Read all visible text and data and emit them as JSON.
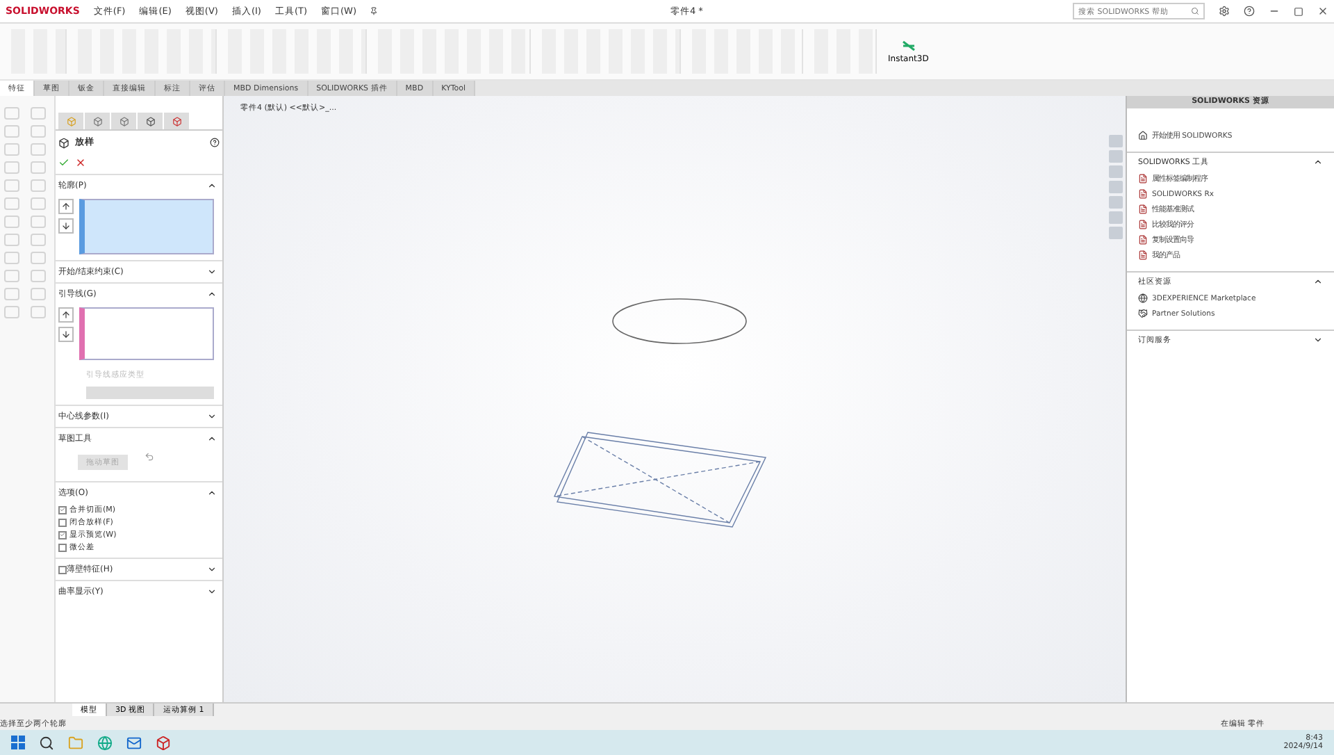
{
  "titlebar": {
    "logo": "SOLIDWORKS",
    "menus": [
      "文件(F)",
      "编辑(E)",
      "视图(V)",
      "插入(I)",
      "工具(T)",
      "窗口(W)"
    ],
    "title": "零件4 *",
    "search": {
      "placeholder": "搜索 SOLIDWORKS 帮助"
    }
  },
  "ribbon": {
    "tool_label": "Instant3D"
  },
  "command_tabs": [
    {
      "label": "特征",
      "selected": true
    },
    {
      "label": "草图",
      "selected": false
    },
    {
      "label": "钣金",
      "selected": false
    },
    {
      "label": "直接编辑",
      "selected": false
    },
    {
      "label": "标注",
      "selected": false
    },
    {
      "label": "评估",
      "selected": false
    },
    {
      "label": "MBD Dimensions",
      "selected": false
    },
    {
      "label": "SOLIDWORKS 插件",
      "selected": false
    },
    {
      "label": "MBD",
      "selected": false
    },
    {
      "label": "KYTool",
      "selected": false
    }
  ],
  "breadcrumb": "零件4 (默认) <<默认>_...",
  "property_manager": {
    "title": "放样",
    "sections": [
      {
        "kind": "profile-list",
        "title": "轮廓(P)",
        "expanded": true,
        "color": "#5a9be0"
      },
      {
        "kind": "plain",
        "title": "开始/结束约束(C)",
        "expanded": false
      },
      {
        "kind": "guide-list",
        "title": "引导线(G)",
        "expanded": true,
        "color": "#e070b0",
        "disabled_label": "引导线感应类型"
      },
      {
        "kind": "plain",
        "title": "中心线参数(I)",
        "expanded": false
      },
      {
        "kind": "tool",
        "title": "草图工具",
        "expanded": true,
        "button": "拖动草图"
      },
      {
        "kind": "options",
        "title": "选项(O)",
        "expanded": true,
        "options": [
          {
            "label": "合并切面(M)",
            "checked": true
          },
          {
            "label": "闭合放样(F)",
            "checked": false
          },
          {
            "label": "显示预览(W)",
            "checked": true
          },
          {
            "label": "微公差",
            "checked": false
          }
        ]
      },
      {
        "kind": "thin",
        "title": "薄壁特征(H)",
        "expanded": false,
        "checked": false
      },
      {
        "kind": "plain",
        "title": "曲率显示(Y)",
        "expanded": false
      }
    ]
  },
  "task_pane": {
    "title": "SOLIDWORKS 资源",
    "start": "开始使用 SOLIDWORKS",
    "groups": [
      {
        "title": "SOLIDWORKS 工具",
        "expanded": true,
        "items": [
          "属性标签编制程序",
          "SOLIDWORKS Rx",
          "性能基准测试",
          "比较我的评分",
          "复制设置向导",
          "我的产品"
        ]
      },
      {
        "title": "社区资源",
        "expanded": true,
        "items": [
          "3DEXPERIENCE Marketplace",
          "Partner Solutions"
        ]
      },
      {
        "title": "订阅服务",
        "expanded": false
      }
    ]
  },
  "bottom_tabs": [
    {
      "label": "模型",
      "selected": true
    },
    {
      "label": "3D 视图",
      "selected": false
    },
    {
      "label": "运动算例 1",
      "selected": false
    }
  ],
  "status": {
    "message": "选择至少两个轮廓",
    "mode": "在编辑 零件"
  },
  "taskbar": {
    "time": "8:43",
    "date": "2024/9/14"
  }
}
